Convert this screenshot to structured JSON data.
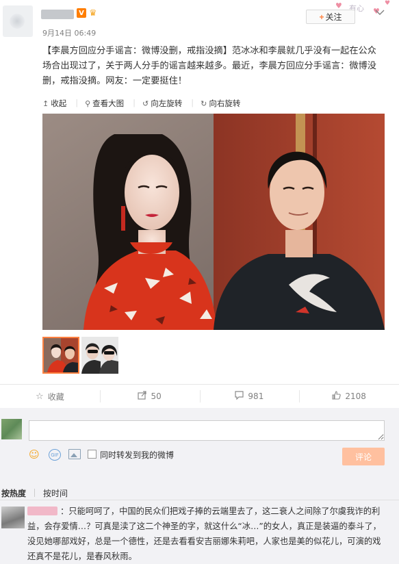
{
  "post": {
    "time": "9月14日 06:49",
    "text": "【李晨方回应分手谣言：微博没删，戒指没摘】范冰冰和李晨就几乎没有一起在公众场合出现过了，关于两人分手的谣言越来越多。最近，李晨方回应分手谣言：微博没删，戒指没摘。网友：一定要挺住！",
    "follow_label": "关注",
    "follow_plus": "+",
    "verified_badge": "V",
    "deco_text": "有心"
  },
  "toolbar": {
    "collapse": "收起",
    "view_large": "查看大图",
    "rotate_left": "向左旋转",
    "rotate_right": "向右旋转"
  },
  "actions": {
    "favorite": "收藏",
    "repost_count": "50",
    "comment_count": "981",
    "like_count": "2108"
  },
  "composer": {
    "repost_label": "同时转发到我的微博",
    "submit_label": "评论",
    "gif_label": "GIF"
  },
  "sort": {
    "hot": "按热度",
    "time": "按时间"
  },
  "comment": {
    "text": "：只能呵呵了，中国的民众们把戏子捧的云端里去了，这二衰人之间除了尔虞我诈的利益，会存爱情…？可真是渎了这二个神圣的字，就这什么“冰…”的女人，真正是装逼的泰斗了，没见她哪部戏好，总是一个德性，还是去看看安吉丽娜朱莉吧，人家也是美的似花儿，可演的戏还真不是花儿，是春风秋雨。"
  },
  "colors": {
    "accent": "#ff8140",
    "submit_disabled": "#ffc09f",
    "background": "#ffffff",
    "comment_area": "#f2f2f5"
  },
  "icons": [
    "fold-icon",
    "search-icon",
    "rotate-left-icon",
    "rotate-right-icon",
    "star-icon",
    "repost-icon",
    "comment-icon",
    "like-icon",
    "emoji-icon",
    "gif-icon",
    "image-icon",
    "chevron-down-icon"
  ]
}
